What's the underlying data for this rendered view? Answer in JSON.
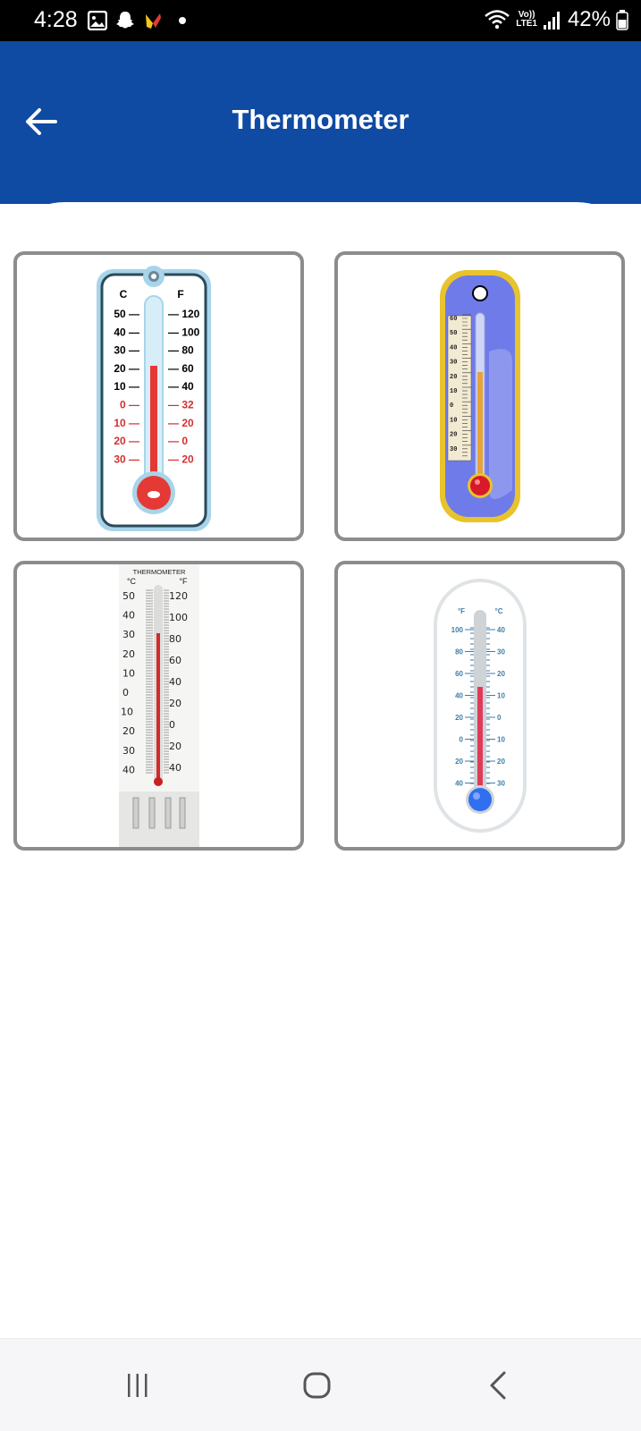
{
  "status_bar": {
    "time": "4:28",
    "lte_label_top": "Vo))",
    "lte_label_bottom": "LTE1",
    "battery": "42%"
  },
  "app_bar": {
    "title": "Thermometer",
    "back_icon": "arrow-left-icon"
  },
  "thermometers": [
    {
      "id": "thermo-1",
      "scale_headers": [
        "C",
        "F"
      ],
      "celsius_labels": [
        "50",
        "40",
        "30",
        "20",
        "10",
        "0",
        "10",
        "20",
        "30"
      ],
      "fahrenheit_labels": [
        "120",
        "100",
        "80",
        "60",
        "40",
        "32",
        "20",
        "0",
        "20"
      ]
    },
    {
      "id": "thermo-2",
      "scale_labels": [
        "60",
        "50",
        "40",
        "30",
        "20",
        "10",
        "0",
        "10",
        "20",
        "30"
      ]
    },
    {
      "id": "thermo-3",
      "caption": "THERMOMETER",
      "scale_headers": [
        "°C",
        "°F"
      ],
      "celsius_labels": [
        "50",
        "40",
        "30",
        "20",
        "10",
        "0",
        "10",
        "20",
        "30",
        "40"
      ],
      "fahrenheit_labels": [
        "120",
        "100",
        "80",
        "60",
        "40",
        "20",
        "0",
        "20",
        "40"
      ]
    },
    {
      "id": "thermo-4",
      "scale_headers": [
        "°F",
        "°C"
      ],
      "fahrenheit_labels": [
        "100",
        "80",
        "60",
        "40",
        "20",
        "0",
        "20",
        "40"
      ],
      "celsius_labels": [
        "40",
        "30",
        "20",
        "10",
        "0",
        "10",
        "20",
        "30"
      ]
    }
  ],
  "nav_bar": {
    "recents_icon": "recents-icon",
    "home_icon": "home-icon",
    "back_icon": "back-chevron-icon"
  }
}
